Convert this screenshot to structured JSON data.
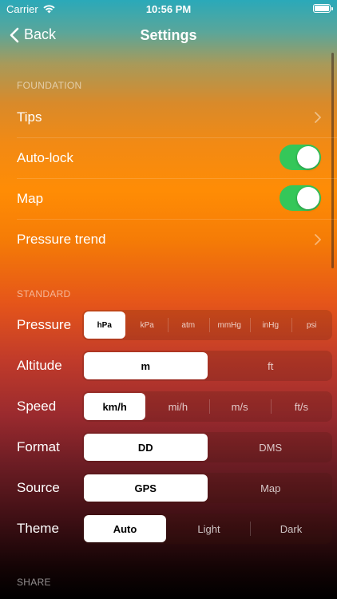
{
  "status": {
    "carrier": "Carrier",
    "time": "10:56 PM"
  },
  "nav": {
    "back_label": "Back",
    "title": "Settings"
  },
  "sections": {
    "foundation": "FOUNDATION",
    "standard": "STANDARD",
    "share": "SHARE"
  },
  "foundation_rows": {
    "tips": "Tips",
    "autolock": "Auto-lock",
    "autolock_on": true,
    "map": "Map",
    "map_on": true,
    "pressure_trend": "Pressure trend"
  },
  "standard_rows": {
    "pressure": {
      "label": "Pressure",
      "options": [
        "hPa",
        "kPa",
        "atm",
        "mmHg",
        "inHg",
        "psi"
      ],
      "selected": "hPa"
    },
    "altitude": {
      "label": "Altitude",
      "options": [
        "m",
        "ft"
      ],
      "selected": "m"
    },
    "speed": {
      "label": "Speed",
      "options": [
        "km/h",
        "mi/h",
        "m/s",
        "ft/s"
      ],
      "selected": "km/h"
    },
    "format": {
      "label": "Format",
      "options": [
        "DD",
        "DMS"
      ],
      "selected": "DD"
    },
    "source": {
      "label": "Source",
      "options": [
        "GPS",
        "Map"
      ],
      "selected": "GPS"
    },
    "theme": {
      "label": "Theme",
      "options": [
        "Auto",
        "Light",
        "Dark"
      ],
      "selected": "Auto"
    }
  },
  "colors": {
    "toggle_on": "#34c759",
    "gradient_top": "#2aa9b9",
    "gradient_mid": "#ff8c05",
    "gradient_bottom": "#000000"
  }
}
